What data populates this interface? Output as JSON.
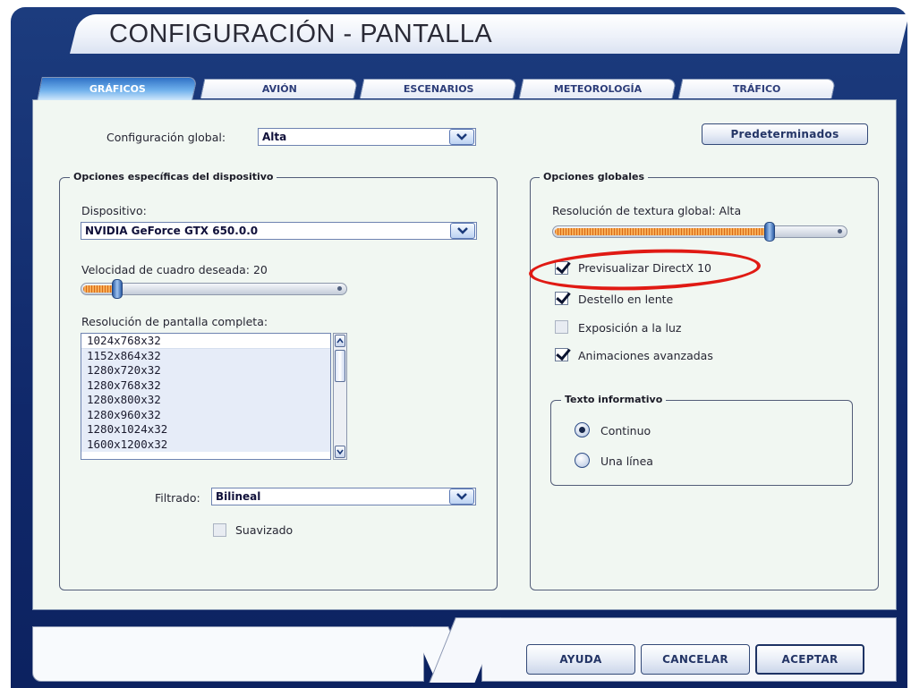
{
  "window": {
    "title": "CONFIGURACIÓN - PANTALLA"
  },
  "tabs": [
    {
      "label": "GRÁFICOS",
      "active": true
    },
    {
      "label": "AVIÓN",
      "active": false
    },
    {
      "label": "ESCENARIOS",
      "active": false
    },
    {
      "label": "METEOROLOGÍA",
      "active": false
    },
    {
      "label": "TRÁFICO",
      "active": false
    }
  ],
  "global_config": {
    "label": "Configuración global:",
    "value": "Alta"
  },
  "defaults_button": "Predeterminados",
  "device_options": {
    "title": "Opciones específicas del dispositivo",
    "device": {
      "label": "Dispositivo:",
      "value": "NVIDIA GeForce GTX 650.0.0"
    },
    "frame_rate": {
      "label": "Velocidad de cuadro deseada: 20",
      "value": 0.12
    },
    "resolution": {
      "label": "Resolución de pantalla completa:",
      "items": [
        "1024x768x32",
        "1152x864x32",
        "1280x720x32",
        "1280x768x32",
        "1280x800x32",
        "1280x960x32",
        "1280x1024x32",
        "1600x1200x32"
      ],
      "selected": "1024x768x32"
    },
    "filter": {
      "label": "Filtrado:",
      "value": "Bilineal"
    },
    "antialias": {
      "label": "Suavizado",
      "checked": false
    }
  },
  "global_options": {
    "title": "Opciones globales",
    "texture": {
      "label": "Resolución de textura global: Alta",
      "value": 0.75
    },
    "checkboxes": [
      {
        "label": "Previsualizar DirectX 10",
        "checked": true
      },
      {
        "label": "Destello en lente",
        "checked": true
      },
      {
        "label": "Exposición a la luz",
        "checked": false
      },
      {
        "label": "Animaciones avanzadas",
        "checked": true
      }
    ],
    "info_text": {
      "title": "Texto informativo",
      "options": [
        {
          "label": "Continuo",
          "selected": true
        },
        {
          "label": "Una línea",
          "selected": false
        }
      ]
    }
  },
  "buttons": {
    "help": "AYUDA",
    "cancel": "CANCELAR",
    "accept": "ACEPTAR"
  },
  "colors": {
    "frame": "#10286a",
    "panel": "#f1f7f2",
    "highlight": "#e01a14",
    "active_tab": "#2f71c6"
  }
}
